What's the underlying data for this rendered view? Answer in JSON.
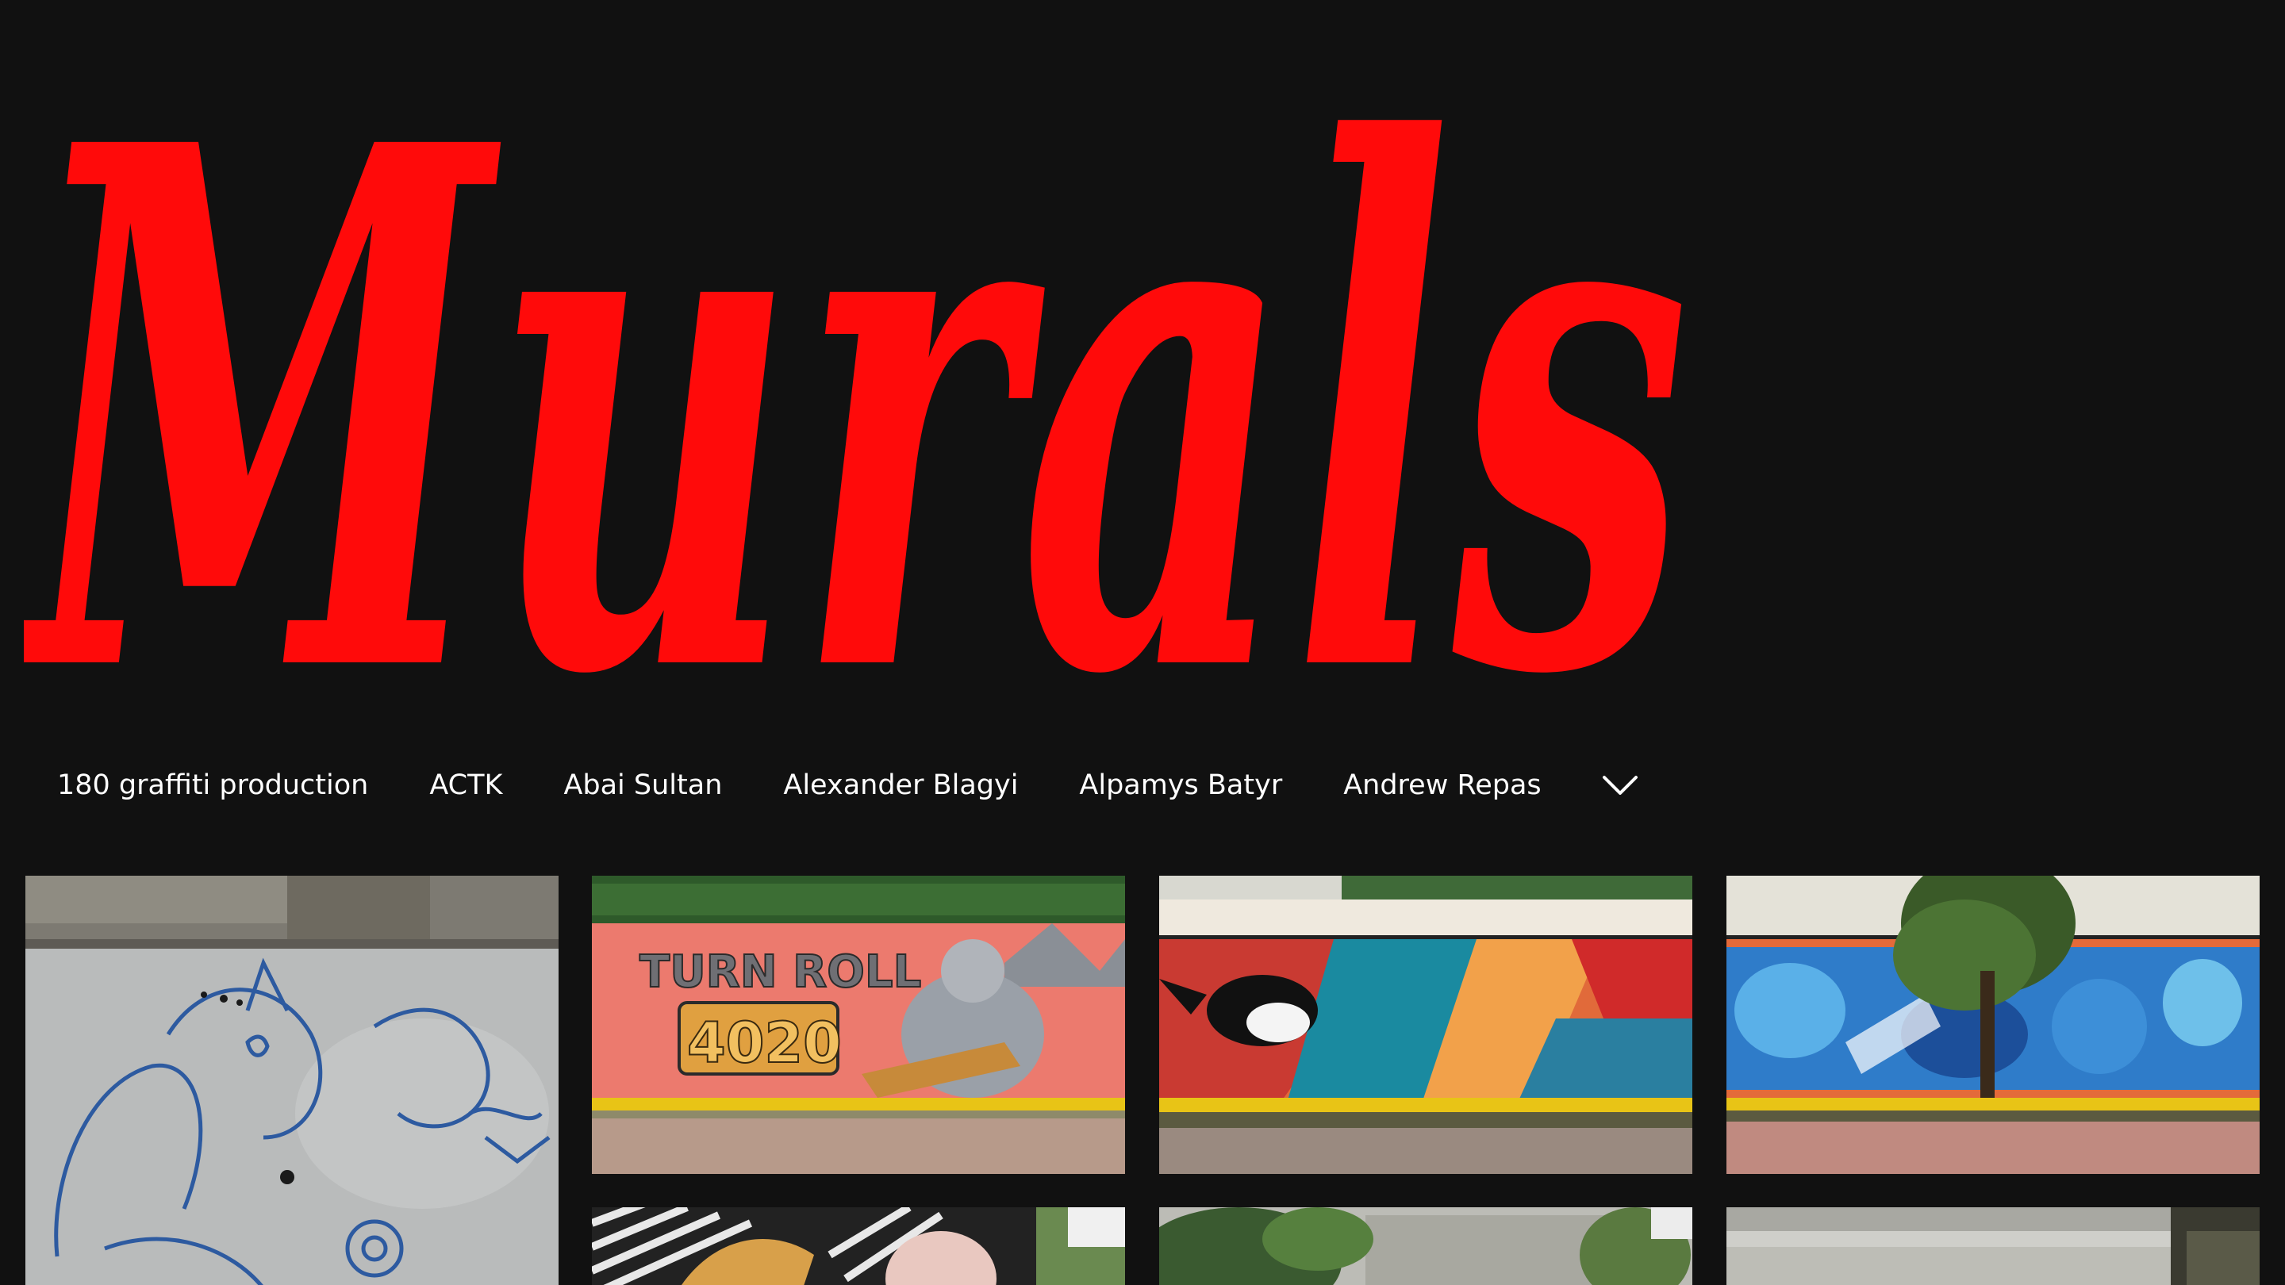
{
  "page": {
    "title": "Murals",
    "title_color": "#ff0a0a",
    "background": "#111111"
  },
  "nav": {
    "items": [
      {
        "label": "180 graffiti production"
      },
      {
        "label": "ACTK"
      },
      {
        "label": "Abai Sultan"
      },
      {
        "label": "Alexander Blagyi"
      },
      {
        "label": "Alpamys Batyr"
      },
      {
        "label": "Andrew Repas"
      }
    ],
    "more_icon": "chevron-down-icon"
  },
  "gallery": {
    "tiles": [
      {
        "name": "gallery-image-1",
        "subject": "blue sketch graffiti on concrete wall"
      },
      {
        "name": "gallery-image-2",
        "subject": "red mural with warrior and graffiti lettering"
      },
      {
        "name": "gallery-image-3",
        "subject": "mural with magpie bird on red, orange and teal"
      },
      {
        "name": "gallery-image-4",
        "subject": "blue character mural behind a tree"
      },
      {
        "name": "gallery-image-5",
        "subject": "black and white striped mural"
      },
      {
        "name": "gallery-image-6",
        "subject": "wall with green foliage"
      },
      {
        "name": "gallery-image-7",
        "subject": "grey concrete wall"
      }
    ]
  }
}
